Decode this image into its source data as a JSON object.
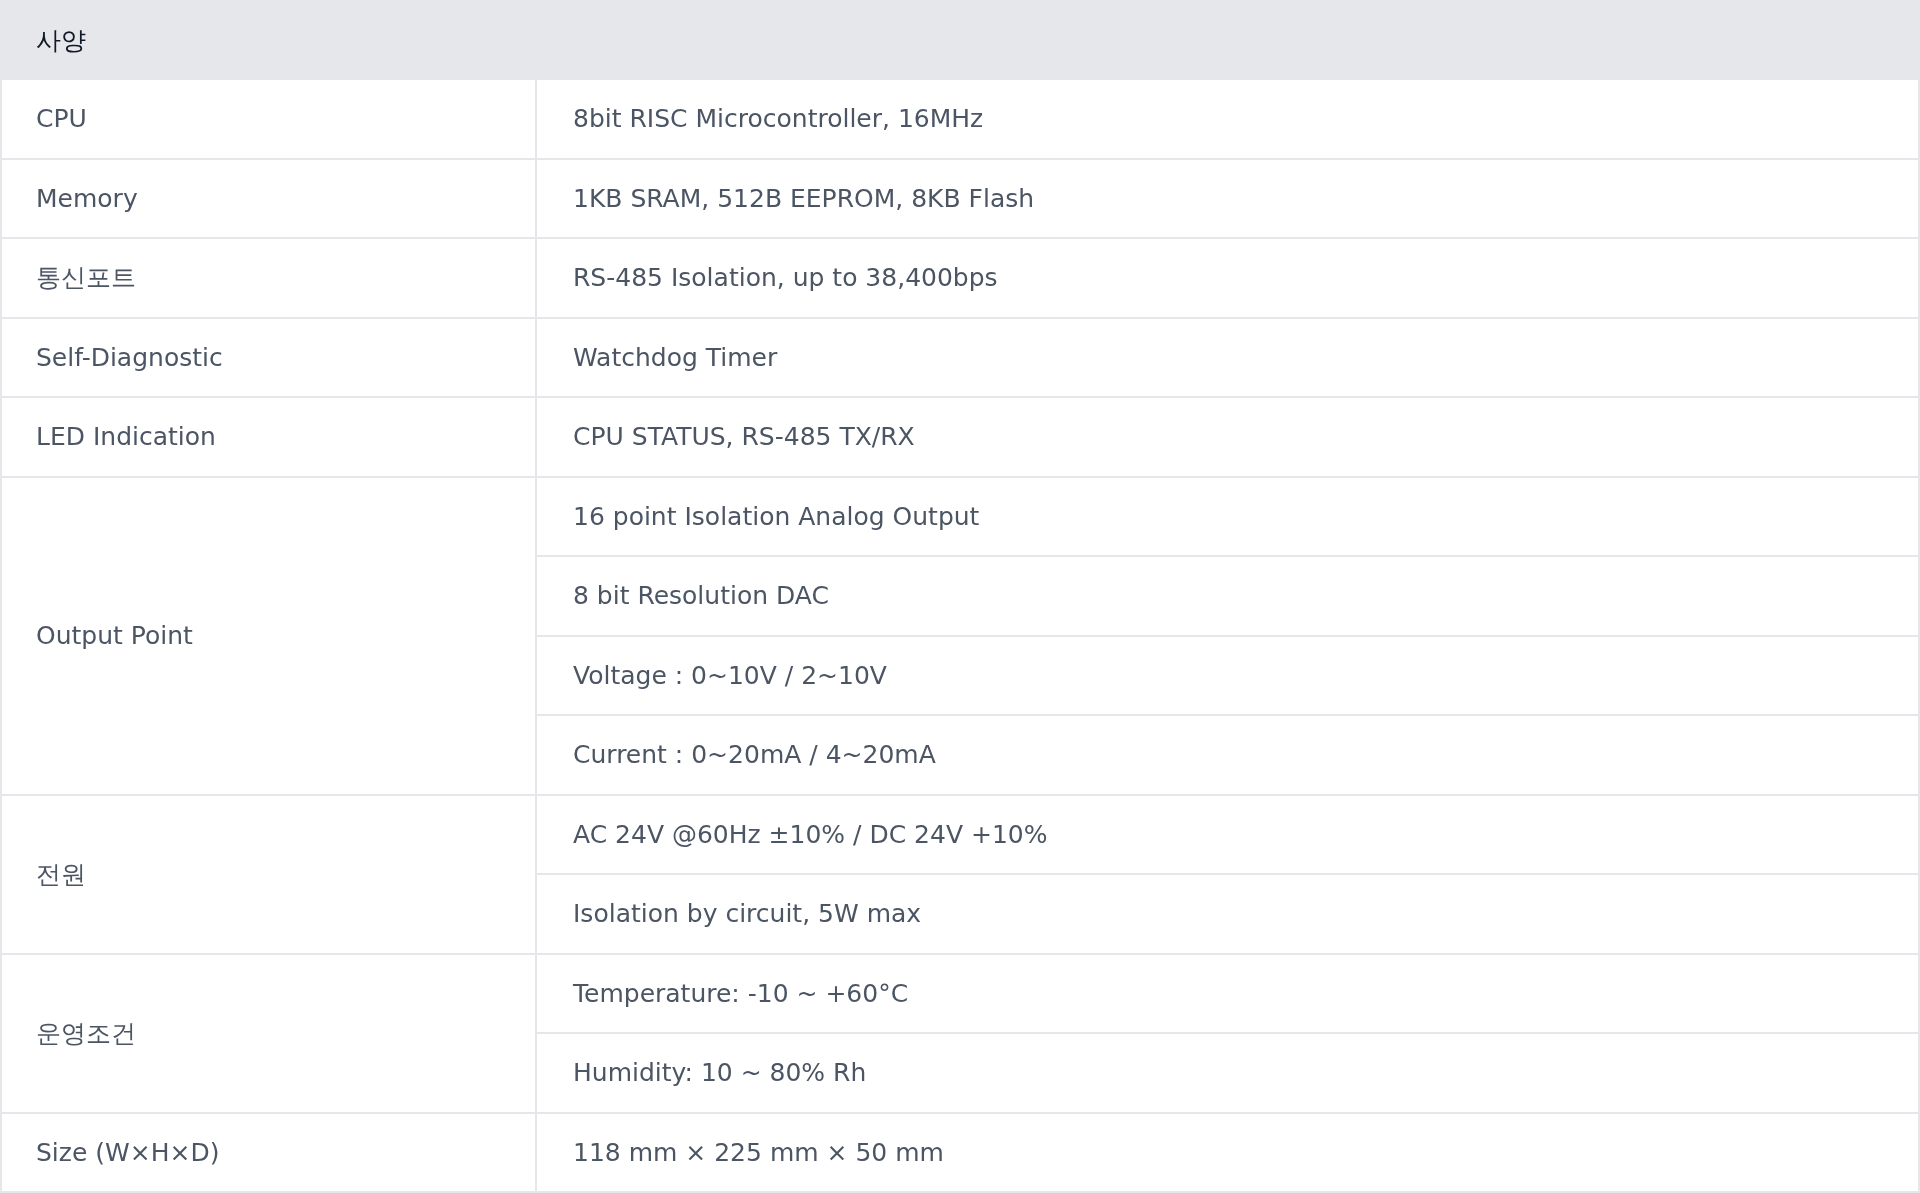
{
  "table": {
    "header": "사양",
    "rows": [
      {
        "label": "CPU",
        "values": [
          "8bit RISC Microcontroller, 16MHz"
        ]
      },
      {
        "label": "Memory",
        "values": [
          "1KB SRAM, 512B EEPROM, 8KB Flash"
        ]
      },
      {
        "label": "통신포트",
        "values": [
          "RS-485 Isolation, up to 38,400bps"
        ]
      },
      {
        "label": "Self-Diagnostic",
        "values": [
          "Watchdog Timer"
        ]
      },
      {
        "label": "LED Indication",
        "values": [
          "CPU STATUS, RS-485 TX/RX"
        ]
      },
      {
        "label": "Output Point",
        "values": [
          "16 point Isolation Analog Output",
          "8 bit Resolution DAC",
          "Voltage : 0~10V / 2~10V",
          "Current : 0~20mA / 4~20mA"
        ]
      },
      {
        "label": "전원",
        "values": [
          "AC 24V @60Hz ±10% / DC 24V +10%",
          "Isolation by circuit, 5W max"
        ]
      },
      {
        "label": "운영조건",
        "values": [
          "Temperature: -10 ~ +60°C",
          "Humidity: 10 ~ 80% Rh"
        ]
      },
      {
        "label": "Size (W×H×D)",
        "values": [
          "118 mm × 225 mm × 50 mm"
        ]
      }
    ]
  }
}
